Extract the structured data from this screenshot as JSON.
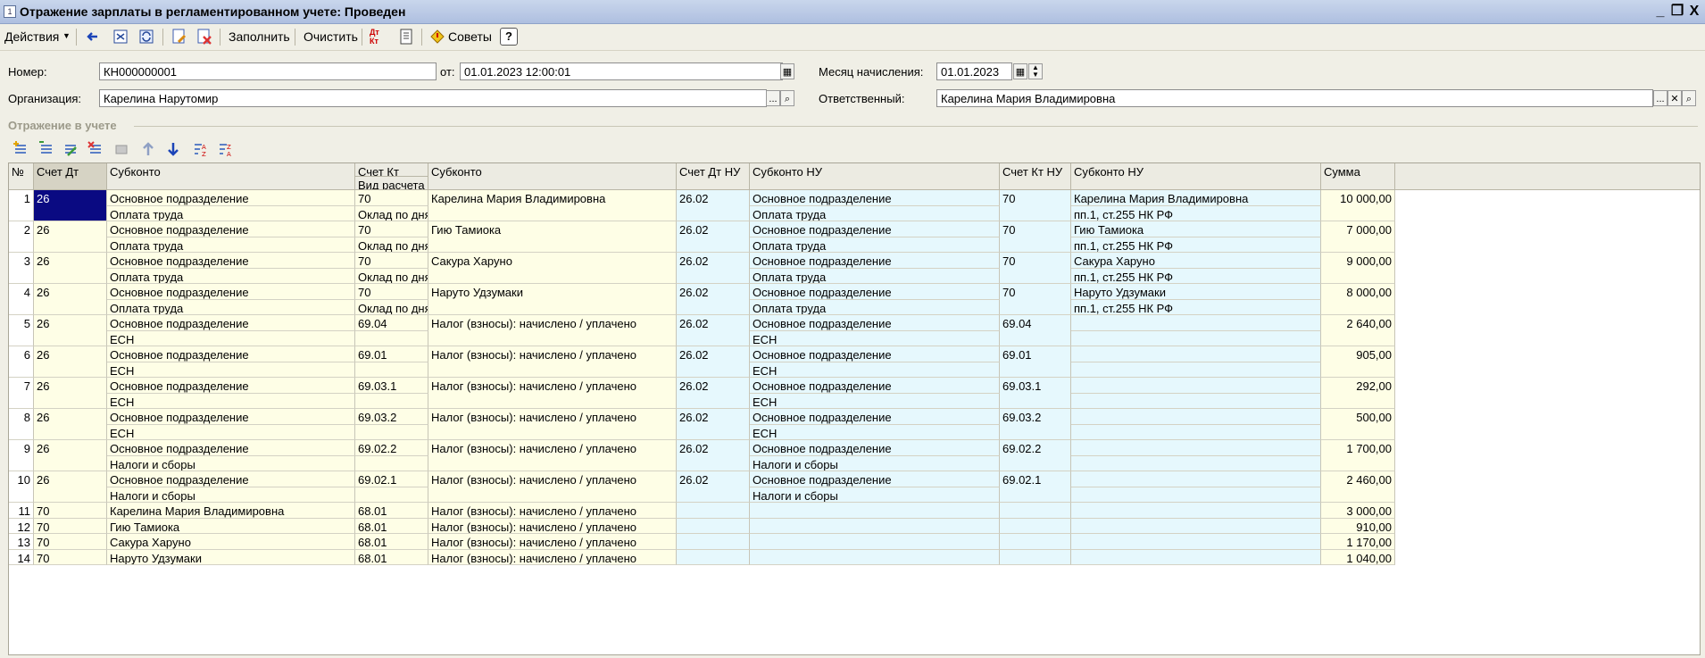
{
  "window": {
    "title": "Отражение зарплаты в регламентированном учете: Проведен",
    "controls": [
      "_",
      "❐",
      "X"
    ]
  },
  "toolbar": {
    "actions_label": "Действия",
    "fill_label": "Заполнить",
    "clear_label": "Очистить",
    "tips_label": "Советы",
    "help_label": "?",
    "dtkt_label": "Дт Кт"
  },
  "form": {
    "number_label": "Номер:",
    "number_value": "КН000000001",
    "date_label": "от:",
    "date_value": "01.01.2023 12:00:01",
    "month_label": "Месяц начисления:",
    "month_value": "01.01.2023",
    "org_label": "Организация:",
    "org_value": "Карелина Нарутомир",
    "resp_label": "Ответственный:",
    "resp_value": "Карелина Мария Владимировна"
  },
  "section": {
    "title": "Отражение в учете"
  },
  "table": {
    "headers": {
      "num": "№",
      "dt": "Счет Дт",
      "sub": "Субконто",
      "kt": "Счет Кт",
      "kt2": "Вид расчета",
      "sub2": "Субконто",
      "dtnu": "Счет Дт НУ",
      "subnu": "Субконто НУ",
      "ktnu": "Счет Кт НУ",
      "subnu2": "Субконто НУ",
      "sum": "Сумма"
    },
    "rows": [
      {
        "n": "1",
        "dt": "26",
        "sub_a": "Основное подразделение",
        "sub_b": "Оплата труда",
        "kt": "70",
        "kt_b": "Оклад по дням",
        "sub2": "Карелина Мария Владимировна",
        "dtnu": "26.02",
        "subnu_a": "Основное подразделение",
        "subnu_b": "Оплата труда",
        "ktnu": "70",
        "subnu2_a": "Карелина Мария Владимировна",
        "subnu2_b": "пп.1, ст.255 НК РФ",
        "sum": "10 000,00"
      },
      {
        "n": "2",
        "dt": "26",
        "sub_a": "Основное подразделение",
        "sub_b": "Оплата труда",
        "kt": "70",
        "kt_b": "Оклад по дням",
        "sub2": "Гию Тамиока",
        "dtnu": "26.02",
        "subnu_a": "Основное подразделение",
        "subnu_b": "Оплата труда",
        "ktnu": "70",
        "subnu2_a": "Гию Тамиока",
        "subnu2_b": "пп.1, ст.255 НК РФ",
        "sum": "7 000,00"
      },
      {
        "n": "3",
        "dt": "26",
        "sub_a": "Основное подразделение",
        "sub_b": "Оплата труда",
        "kt": "70",
        "kt_b": "Оклад по дням",
        "sub2": "Сакура Харуно",
        "dtnu": "26.02",
        "subnu_a": "Основное подразделение",
        "subnu_b": "Оплата труда",
        "ktnu": "70",
        "subnu2_a": "Сакура Харуно",
        "subnu2_b": "пп.1, ст.255 НК РФ",
        "sum": "9 000,00"
      },
      {
        "n": "4",
        "dt": "26",
        "sub_a": "Основное подразделение",
        "sub_b": "Оплата труда",
        "kt": "70",
        "kt_b": "Оклад по дням",
        "sub2": "Наруто Удзумаки",
        "dtnu": "26.02",
        "subnu_a": "Основное подразделение",
        "subnu_b": "Оплата труда",
        "ktnu": "70",
        "subnu2_a": "Наруто Удзумаки",
        "subnu2_b": "пп.1, ст.255 НК РФ",
        "sum": "8 000,00"
      },
      {
        "n": "5",
        "dt": "26",
        "sub_a": "Основное подразделение",
        "sub_b": "ЕСН",
        "kt": "69.04",
        "kt_b": "",
        "sub2": "Налог (взносы): начислено / уплачено",
        "dtnu": "26.02",
        "subnu_a": "Основное подразделение",
        "subnu_b": "ЕСН",
        "ktnu": "69.04",
        "subnu2_a": "",
        "subnu2_b": "",
        "sum": "2 640,00"
      },
      {
        "n": "6",
        "dt": "26",
        "sub_a": "Основное подразделение",
        "sub_b": "ЕСН",
        "kt": "69.01",
        "kt_b": "",
        "sub2": "Налог (взносы): начислено / уплачено",
        "dtnu": "26.02",
        "subnu_a": "Основное подразделение",
        "subnu_b": "ЕСН",
        "ktnu": "69.01",
        "subnu2_a": "",
        "subnu2_b": "",
        "sum": "905,00"
      },
      {
        "n": "7",
        "dt": "26",
        "sub_a": "Основное подразделение",
        "sub_b": "ЕСН",
        "kt": "69.03.1",
        "kt_b": "",
        "sub2": "Налог (взносы): начислено / уплачено",
        "dtnu": "26.02",
        "subnu_a": "Основное подразделение",
        "subnu_b": "ЕСН",
        "ktnu": "69.03.1",
        "subnu2_a": "",
        "subnu2_b": "",
        "sum": "292,00"
      },
      {
        "n": "8",
        "dt": "26",
        "sub_a": "Основное подразделение",
        "sub_b": "ЕСН",
        "kt": "69.03.2",
        "kt_b": "",
        "sub2": "Налог (взносы): начислено / уплачено",
        "dtnu": "26.02",
        "subnu_a": "Основное подразделение",
        "subnu_b": "ЕСН",
        "ktnu": "69.03.2",
        "subnu2_a": "",
        "subnu2_b": "",
        "sum": "500,00"
      },
      {
        "n": "9",
        "dt": "26",
        "sub_a": "Основное подразделение",
        "sub_b": "Налоги и сборы",
        "kt": "69.02.2",
        "kt_b": "",
        "sub2": "Налог (взносы): начислено / уплачено",
        "dtnu": "26.02",
        "subnu_a": "Основное подразделение",
        "subnu_b": "Налоги и сборы",
        "ktnu": "69.02.2",
        "subnu2_a": "",
        "subnu2_b": "",
        "sum": "1 700,00"
      },
      {
        "n": "10",
        "dt": "26",
        "sub_a": "Основное подразделение",
        "sub_b": "Налоги и сборы",
        "kt": "69.02.1",
        "kt_b": "",
        "sub2": "Налог (взносы): начислено / уплачено",
        "dtnu": "26.02",
        "subnu_a": "Основное подразделение",
        "subnu_b": "Налоги и сборы",
        "ktnu": "69.02.1",
        "subnu2_a": "",
        "subnu2_b": "",
        "sum": "2 460,00"
      },
      {
        "n": "11",
        "dt": "70",
        "sub_a": "Карелина Мария Владимировна",
        "sub_b": "",
        "kt": "68.01",
        "kt_b": "",
        "sub2": "Налог (взносы): начислено / уплачено",
        "dtnu": "",
        "subnu_a": "",
        "subnu_b": "",
        "ktnu": "",
        "subnu2_a": "",
        "subnu2_b": "",
        "sum": "3 000,00"
      },
      {
        "n": "12",
        "dt": "70",
        "sub_a": "Гию Тамиока",
        "sub_b": "",
        "kt": "68.01",
        "kt_b": "",
        "sub2": "Налог (взносы): начислено / уплачено",
        "dtnu": "",
        "subnu_a": "",
        "subnu_b": "",
        "ktnu": "",
        "subnu2_a": "",
        "subnu2_b": "",
        "sum": "910,00"
      },
      {
        "n": "13",
        "dt": "70",
        "sub_a": "Сакура Харуно",
        "sub_b": "",
        "kt": "68.01",
        "kt_b": "",
        "sub2": "Налог (взносы): начислено / уплачено",
        "dtnu": "",
        "subnu_a": "",
        "subnu_b": "",
        "ktnu": "",
        "subnu2_a": "",
        "subnu2_b": "",
        "sum": "1 170,00"
      },
      {
        "n": "14",
        "dt": "70",
        "sub_a": "Наруто Удзумаки",
        "sub_b": "",
        "kt": "68.01",
        "kt_b": "",
        "sub2": "Налог (взносы): начислено / уплачено",
        "dtnu": "",
        "subnu_a": "",
        "subnu_b": "",
        "ktnu": "",
        "subnu2_a": "",
        "subnu2_b": "",
        "sum": "1 040,00"
      }
    ]
  },
  "icons": {
    "toolbar": [
      "back-arrow-icon",
      "doc-icon",
      "refresh-icon",
      "post-icon",
      "unpost-icon",
      "dtkt-icon",
      "journal-icon",
      "tips-icon"
    ],
    "grid": [
      "add-row-icon",
      "copy-row-icon",
      "edit-row-icon",
      "delete-row-icon",
      "end-edit-icon",
      "move-up-icon",
      "move-down-icon",
      "sort-asc-icon",
      "sort-desc-icon"
    ]
  },
  "colors": {
    "title_bar": "#aebfe0",
    "row_yellow": "#fefee6",
    "row_blue": "#e6f8fd",
    "selection": "#0a0a82"
  }
}
